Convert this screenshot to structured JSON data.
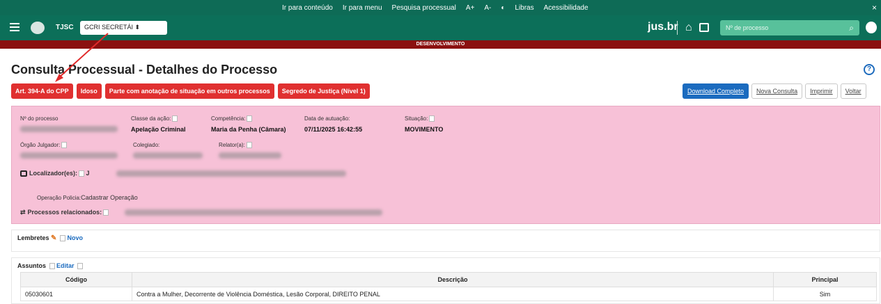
{
  "topbar": {
    "links": [
      "Ir para conteúdo",
      "Ir para menu",
      "Pesquisa processual",
      "A+",
      "A-",
      "◐",
      "Libras",
      "Acessibilidade"
    ],
    "close": "×"
  },
  "navbar": {
    "org": "TJSC",
    "profile": "GCRI            SECRETÁI ⬍",
    "brand": "jus.br",
    "search_placeholder": "Nº de processo"
  },
  "environment": "DESENVOLVIMENTO",
  "page": {
    "title": "Consulta Processual - Detalhes do Processo",
    "help": "?"
  },
  "tags": [
    "Art. 394-A do CPP",
    "Idoso",
    "Parte com anotação de situação em outros processos",
    "Segredo de Justiça (Nível 1)"
  ],
  "actions": [
    "Download Completo",
    "Nova Consulta",
    "Imprimir",
    "Voltar"
  ],
  "details": {
    "numero_label": "Nº do processo",
    "classe_label": "Classe da ação:",
    "classe_value": "Apelação Criminal",
    "competencia_label": "Competência:",
    "competencia_value": "Maria da Penha (Câmara)",
    "data_label": "Data de autuação:",
    "data_value": "07/11/2025 16:42:55",
    "situacao_label": "Situação:",
    "situacao_value": "MOVIMENTO",
    "orgao_label": "Órgão Julgador:",
    "colegiado_label": "Colegiado:",
    "relator_label": "Relator(a):",
    "localizadores_label": "Localizador(es):",
    "localizadores_prefix": "J",
    "operacao_label": "Operação Policia:",
    "operacao_value": "Cadastrar Operação",
    "relacionados_label": "Processos relacionados:"
  },
  "lembretes": {
    "title": "Lembretes",
    "new": "Novo"
  },
  "assuntos": {
    "title": "Assuntos",
    "edit": "Editar",
    "headers": [
      "Código",
      "Descrição",
      "Principal"
    ],
    "rows": [
      {
        "codigo": "05030601",
        "descricao": "Contra a Mulher, Decorrente de Violência Doméstica, Lesão Corporal, DIREITO PENAL",
        "principal": "Sim"
      }
    ]
  },
  "colors": {
    "topbar": "#0e6b56",
    "environment": "#8b1010",
    "tag": "#e03030",
    "details": "#f7c1d7",
    "primary": "#1b6bbf"
  }
}
